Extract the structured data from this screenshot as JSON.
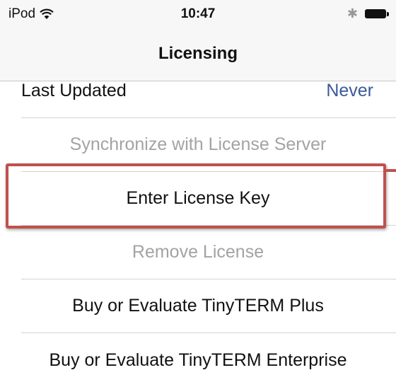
{
  "status_bar": {
    "carrier": "iPod",
    "wifi_icon": "wifi-icon",
    "time": "10:47",
    "bluetooth_icon": "bluetooth-icon",
    "battery_icon": "battery-icon"
  },
  "nav": {
    "title": "Licensing"
  },
  "rows": [
    {
      "label": "Last Updated",
      "value": "Never"
    },
    {
      "label": "Synchronize with License Server",
      "enabled": false
    },
    {
      "label": "Enter License Key",
      "enabled": true,
      "highlighted": true
    },
    {
      "label": "Remove License",
      "enabled": false
    },
    {
      "label": "Buy or Evaluate TinyTERM Plus",
      "enabled": true
    },
    {
      "label": "Buy or Evaluate TinyTERM Enterprise",
      "enabled": true
    }
  ],
  "colors": {
    "highlight": "#c0504d",
    "value_text": "#3a5a99",
    "disabled_text": "#a3a3a3"
  }
}
